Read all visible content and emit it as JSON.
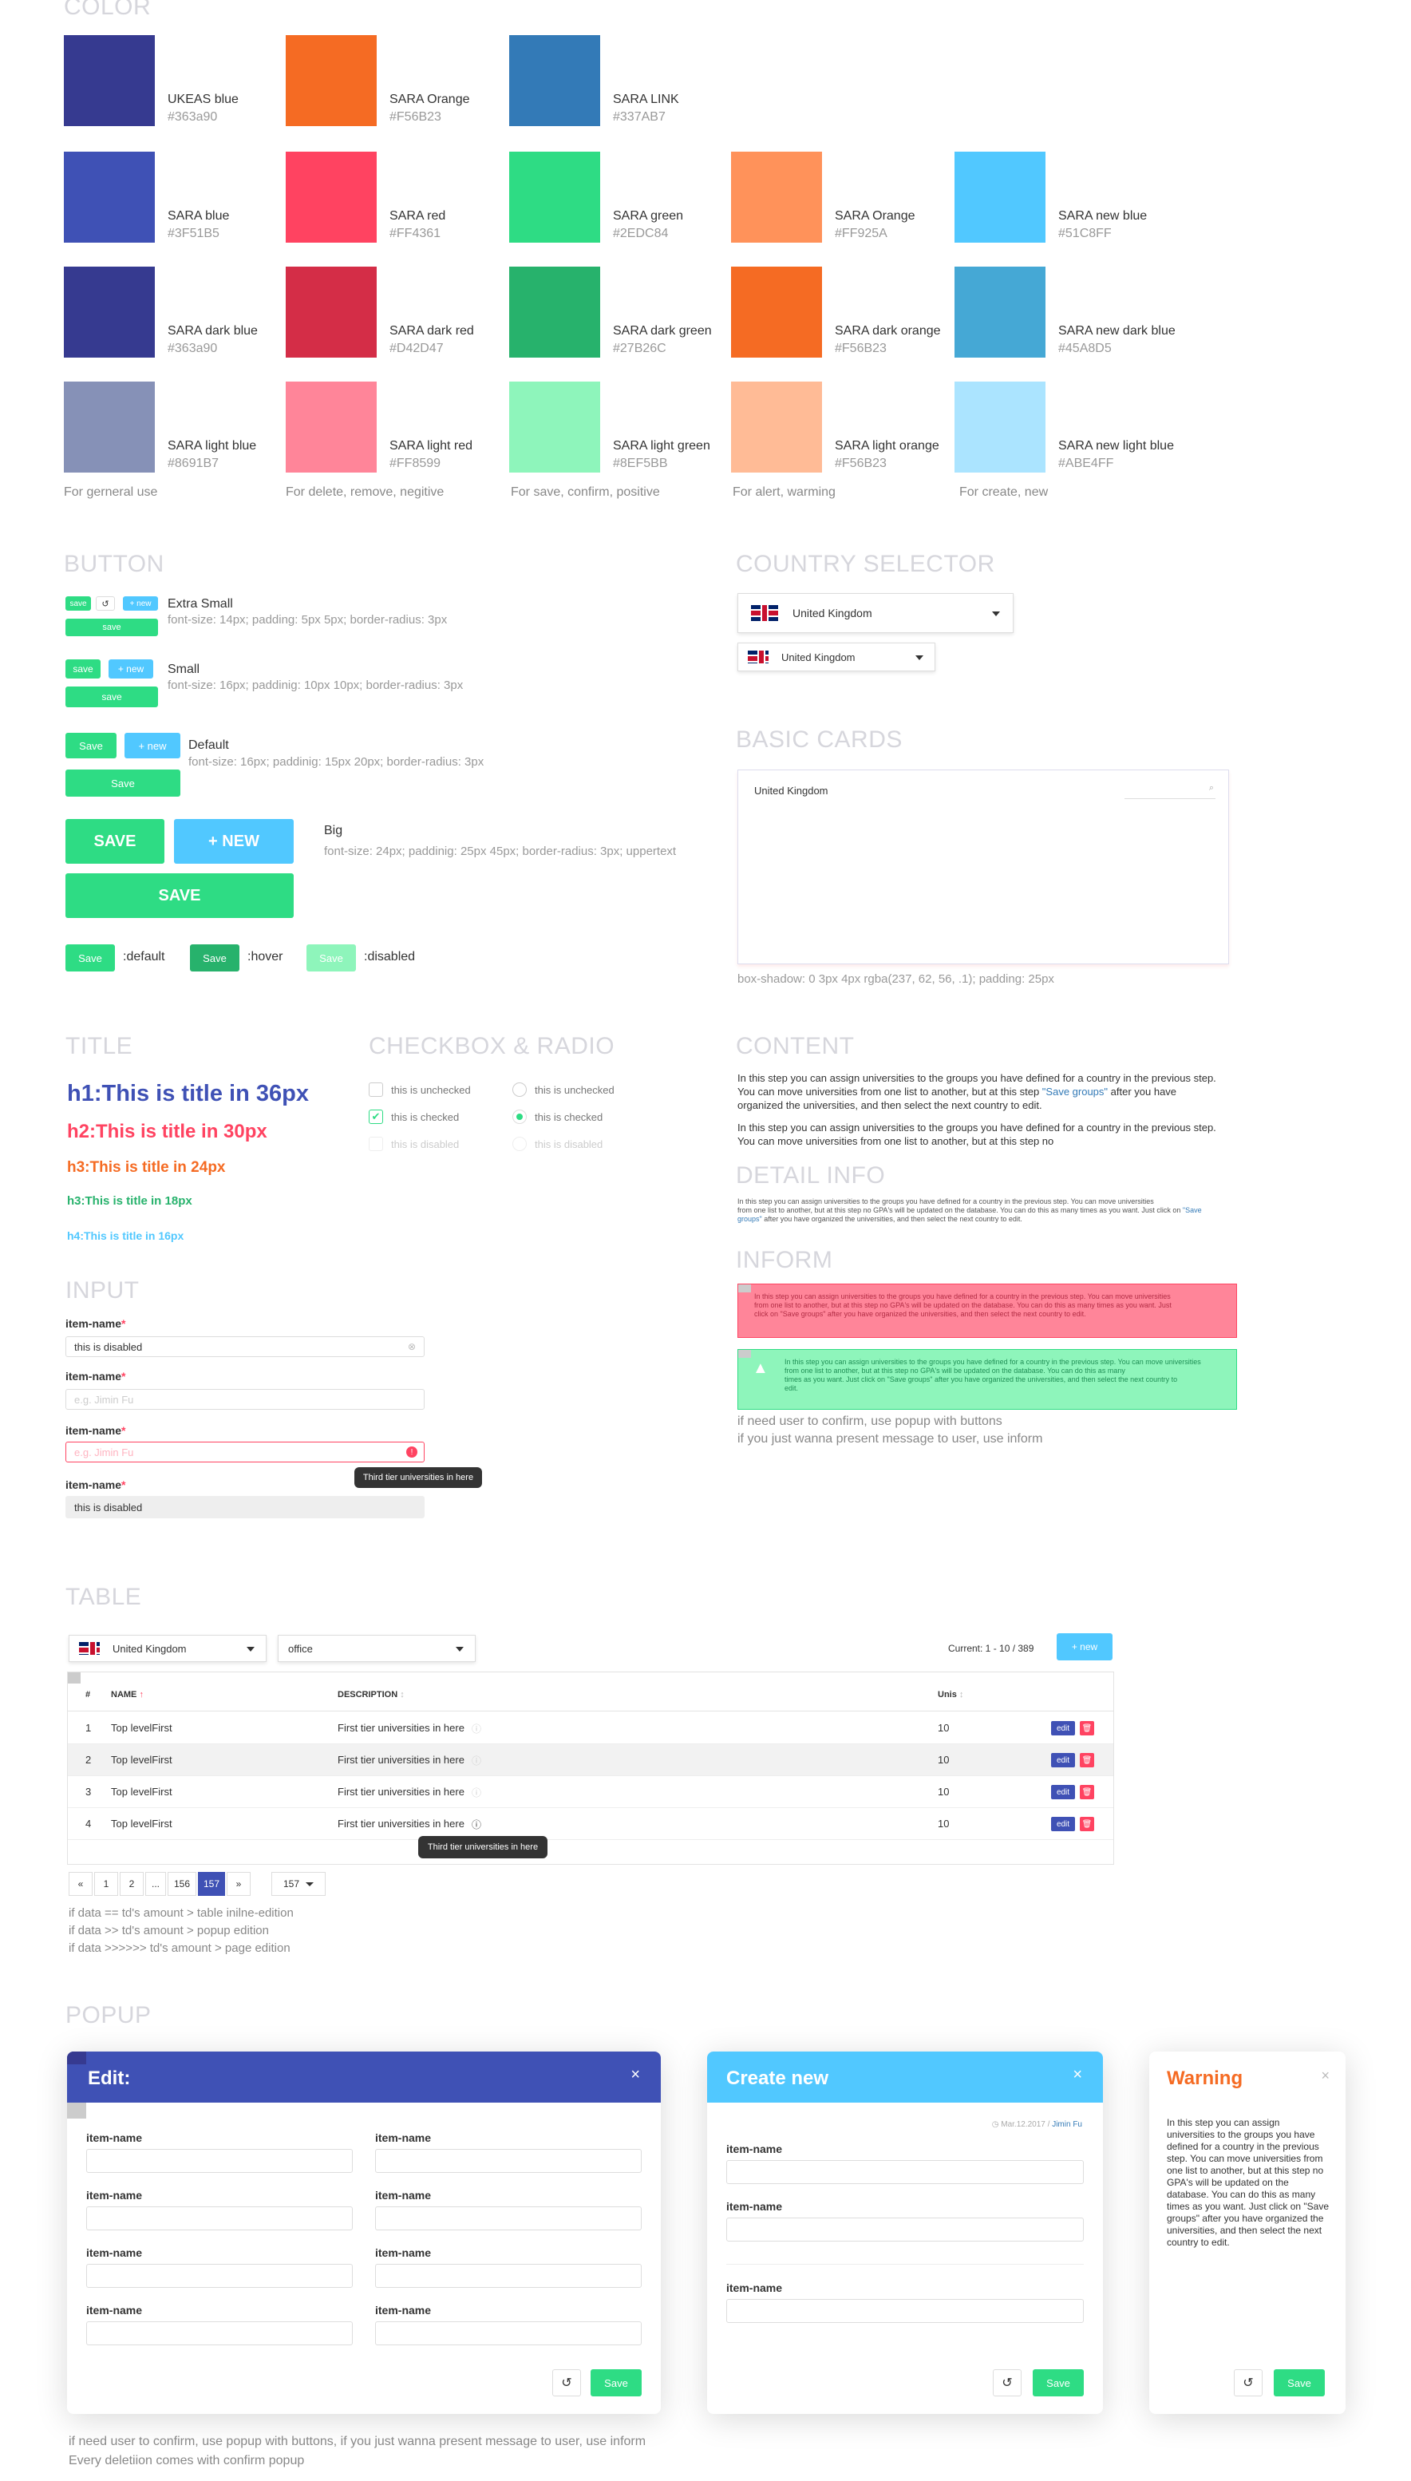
{
  "color": {
    "title": "COLOR",
    "swatches": [
      {
        "name": "UKEAS blue",
        "hex": "#363a90"
      },
      {
        "name": "SARA Orange",
        "hex": "#F56B23"
      },
      {
        "name": "SARA LINK",
        "hex": "#337AB7"
      },
      {
        "name": "SARA blue",
        "hex": "#3F51B5"
      },
      {
        "name": "SARA red",
        "hex": "#FF4361"
      },
      {
        "name": "SARA green",
        "hex": "#2EDC84"
      },
      {
        "name": "SARA Orange",
        "hex": "#FF925A"
      },
      {
        "name": "SARA new blue",
        "hex": "#51C8FF"
      },
      {
        "name": "SARA dark blue",
        "hex": "#363a90"
      },
      {
        "name": "SARA dark red",
        "hex": "#D42D47"
      },
      {
        "name": "SARA dark green",
        "hex": "#27B26C"
      },
      {
        "name": "SARA dark orange",
        "hex": "#F56B23"
      },
      {
        "name": "SARA new dark blue",
        "hex": "#45A8D5"
      },
      {
        "name": "SARA light blue",
        "hex": "#8691B7"
      },
      {
        "name": "SARA light red",
        "hex": "#FF8599"
      },
      {
        "name": "SARA light green",
        "hex": "#8EF5BB"
      },
      {
        "name": "SARA light orange",
        "hex": "#F56B23"
      },
      {
        "name": "SARA new light blue",
        "hex": "#ABE4FF"
      }
    ],
    "swatch_colors": [
      "#363a90",
      "#F56B23",
      "#337AB7",
      "#3F51B5",
      "#FF4361",
      "#2EDC84",
      "#FF925A",
      "#51C8FF",
      "#363a90",
      "#D42D47",
      "#27B26C",
      "#F56B23",
      "#45A8D5",
      "#8691B7",
      "#FF8599",
      "#8EF5BB",
      "#FFBB96",
      "#ABE4FF"
    ],
    "usage": [
      "For gerneral use",
      "For delete, remove, negitive",
      "For save, confirm, positive",
      "For alert, warming",
      "For create, new"
    ]
  },
  "button": {
    "title": "BUTTON",
    "save": "save",
    "new": "+ new",
    "save_cap": "Save",
    "new_cap": "+ new",
    "save_big": "SAVE",
    "new_big": "+ NEW",
    "sizes": [
      {
        "name": "Extra Small",
        "desc": "font-size: 14px; padding: 5px 5px; border-radius: 3px"
      },
      {
        "name": "Small",
        "desc": "font-size: 16px; paddinig: 10px 10px; border-radius: 3px"
      },
      {
        "name": "Default",
        "desc": "font-size: 16px; paddinig: 15px 20px; border-radius: 3px"
      },
      {
        "name": "Big",
        "desc": "font-size: 24px; paddinig: 25px 45px; border-radius: 3px; uppertext"
      }
    ],
    "states": [
      ":default",
      ":hover",
      ":disabled"
    ]
  },
  "country": {
    "title": "COUNTRY SELECTOR",
    "value": "United Kingdom"
  },
  "cards": {
    "title": "BASIC CARDS",
    "value": "United Kingdom",
    "desc": "box-shadow: 0 3px 4px rgba(237, 62, 56, .1); padding: 25px"
  },
  "titles": {
    "title": "TITLE",
    "h1": "h1:This is title in 36px",
    "h2": "h2:This is title in 30px",
    "h3": "h3:This is title in 24px",
    "h4a": "h3:This is title in 18px",
    "h4": "h4:This is title in 16px"
  },
  "checkbox": {
    "title": "CHECKBOX & RADIO",
    "unchecked": "this is unchecked",
    "checked": "this is checked",
    "disabled": "this is disabled"
  },
  "content": {
    "title": "CONTENT",
    "p1a": "In this step you can assign universities to the groups you have defined for a country in the previous step.",
    "p1b": "You can move universities from one list to another, but at this step ",
    "p1link": "\"Save groups\"",
    "p1c": " after you have",
    "p1d": "organized the universities, and then select the next country to edit.",
    "p2a": "In this step you can assign universities to the groups you have defined for a country in the previous step.",
    "p2b": "You can move universities from one list to another, but at this step no"
  },
  "detail": {
    "title": "DETAIL INFO",
    "text1": "In this step you can assign universities to the groups you have defined for a country in the previous step. You can move universities",
    "text2": "from one list to another, but at this step no GPA's will be updated on the database. You can do this as many times as you want. Just click on ",
    "link": "\"Save",
    "text3": "groups\"",
    "text4": " after you have organized the universities, and then select the next country to edit."
  },
  "inform": {
    "title": "INFORM",
    "red1": "In this step you can assign universities to the groups you have defined for a country in the previous step. You can move universities",
    "red2": "from one list to another, but at this step no GPA's will be updated on the database. You can do this as many times as you want. Just",
    "red3": "click on \"Save groups\" after you have organized the universities, and then select the next country to edit.",
    "green1": "In this step you can assign universities to the groups you have defined for a country in the previous step. You can move universities",
    "green2": "from one list to another, but at this step no GPA's will be updated on the database. You can do this as many",
    "green3": "times as you want. Just click on \"Save groups\" after you have organized the universities, and then select the next country to",
    "green4": "edit.",
    "note1": "if need user to confirm, use popup with buttons",
    "note2": "if you just wanna present message to user, use inform"
  },
  "input": {
    "title": "INPUT",
    "label": "item-name",
    "req": "*",
    "disabled_val": "this is disabled",
    "placeholder": "e.g. Jimin Fu",
    "tip": "Third tier universities in here"
  },
  "table": {
    "title": "TABLE",
    "country": "United Kingdom",
    "filter": "office",
    "current": "Current: 1 - 10 / 389",
    "new_btn": "+ new",
    "headers": [
      "#",
      "NAME",
      "DESCRIPTION",
      "Unis"
    ],
    "rows": [
      {
        "n": "1",
        "name": "Top levelFirst",
        "desc": "First tier universities in here",
        "unis": "10"
      },
      {
        "n": "2",
        "name": "Top levelFirst",
        "desc": "First tier universities in here",
        "unis": "10"
      },
      {
        "n": "3",
        "name": "Top levelFirst",
        "desc": "First tier universities in here",
        "unis": "10"
      },
      {
        "n": "4",
        "name": "Top levelFirst",
        "desc": "First tier universities in here",
        "unis": "10"
      }
    ],
    "edit": "edit",
    "tip": "Third tier universities in here",
    "pages": [
      "«",
      "1",
      "2",
      "...",
      "156",
      "157",
      "»"
    ],
    "page_select": "157",
    "notes": [
      "if data == td's amount > table inilne-edition",
      "if data >> td's amount > popup edition",
      "if data >>>>>> td's amount > page edition"
    ]
  },
  "popup": {
    "title": "POPUP",
    "edit_title": "Edit:",
    "create_title": "Create new",
    "warning_title": "Warning",
    "close": "×",
    "label": "item-name",
    "save": "Save",
    "date": "Mar.12.2017 / ",
    "author": "Jimin Fu",
    "warning_text": "In this step you can assign universities to the groups you have defined for a country in the previous step. You can move universities from one list to another, but at this step no GPA's will be updated on the database. You can do this as many times as you want. Just click on \"Save groups\" after you have organized the universities, and then select the next country to edit.",
    "note1": "if need user to confirm, use popup with buttons, if you just wanna present message to user, use inform",
    "note2": "Every deletiion comes with confirm popup"
  }
}
